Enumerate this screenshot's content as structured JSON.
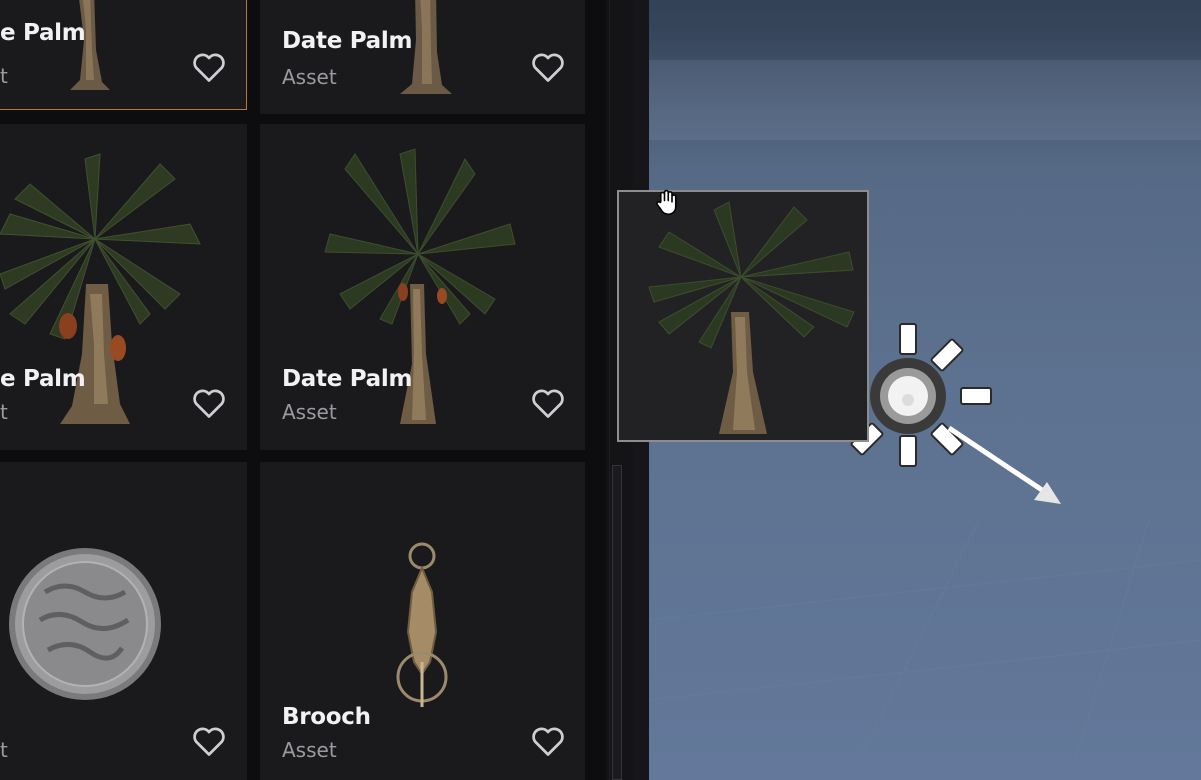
{
  "cards": [
    {
      "title": "Date Palm",
      "subtitle": "Asset",
      "shown_title": "e Palm",
      "shown_sub": "t"
    },
    {
      "title": "Date Palm",
      "subtitle": "Asset"
    },
    {
      "title": "Date Palm",
      "subtitle": "Asset",
      "shown_title": "e Palm",
      "shown_sub": "t"
    },
    {
      "title": "Date Palm",
      "subtitle": "Asset"
    },
    {
      "title": "",
      "subtitle": "Asset",
      "shown_title": "",
      "shown_sub": "t"
    },
    {
      "title": "Brooch",
      "subtitle": "Asset"
    }
  ],
  "icons": {
    "favorite": "heart-outline-icon",
    "cursor": "hand-grab-icon",
    "light": "directional-light-icon"
  },
  "colors": {
    "selected_border": "#b9772f",
    "card_bg": "#1a1a1d",
    "viewport_sky": "#5d7290"
  }
}
